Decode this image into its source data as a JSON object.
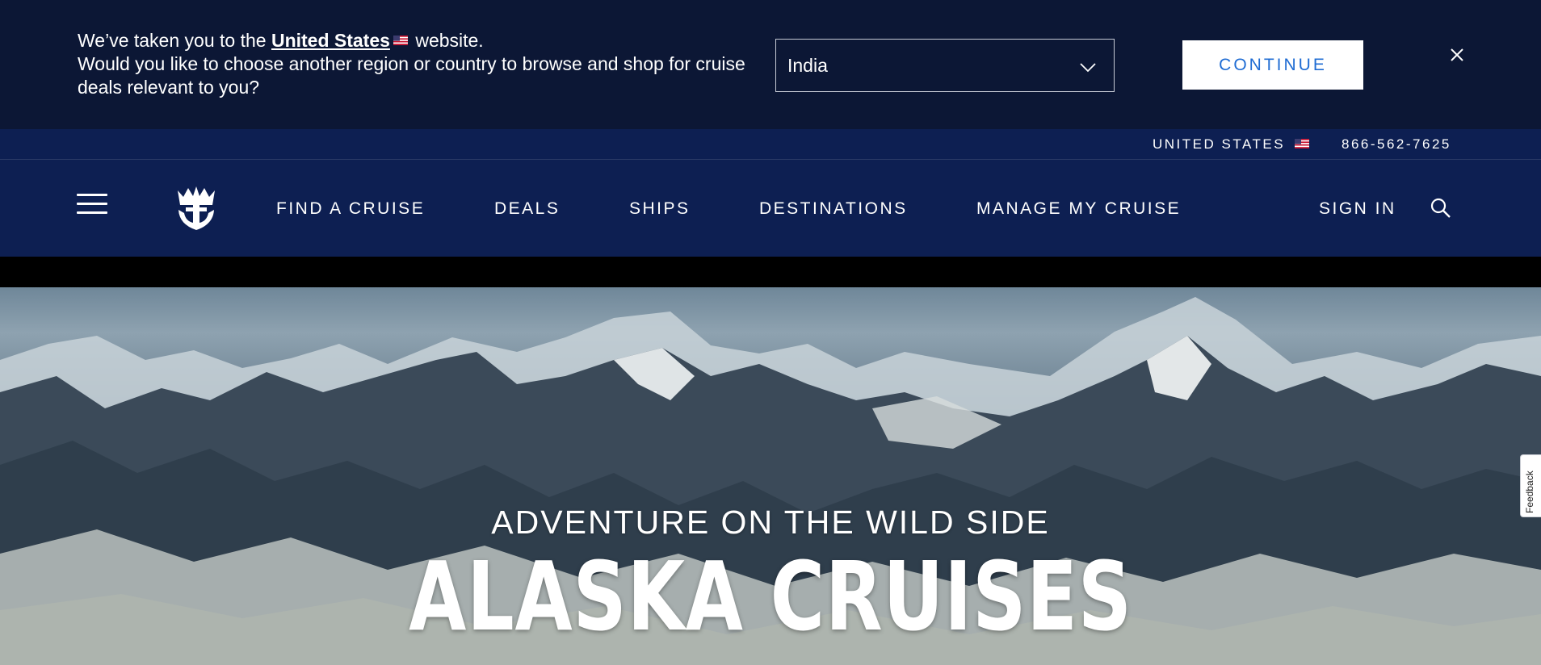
{
  "region_banner": {
    "message_prefix": "We’ve taken you to the ",
    "country_link": "United States",
    "message_suffix": " website.",
    "message_line2": "Would you like to choose another region or country to browse and shop for cruise deals relevant to you?",
    "selected_region": "India",
    "continue_label": "CONTINUE",
    "flag_icon": "us-flag-icon",
    "close_icon": "close-icon"
  },
  "utility_bar": {
    "country": "UNITED STATES",
    "phone": "866-562-7625"
  },
  "nav": {
    "menu_icon": "hamburger-menu-icon",
    "logo_icon": "crown-anchor-logo-icon",
    "items": [
      "FIND A CRUISE",
      "DEALS",
      "SHIPS",
      "DESTINATIONS",
      "MANAGE MY CRUISE"
    ],
    "sign_in": "SIGN IN",
    "search_icon": "search-icon"
  },
  "hero": {
    "subtitle": "ADVENTURE ON THE WILD SIDE",
    "title": "ALASKA CRUISES"
  },
  "feedback": {
    "label": "Feedback"
  },
  "colors": {
    "banner_bg": "#0c1735",
    "nav_bg": "#0d1f52",
    "continue_text": "#1f6cd3"
  }
}
